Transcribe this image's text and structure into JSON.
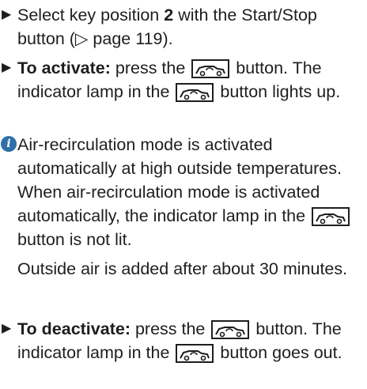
{
  "steps": [
    {
      "text_before": "Select key position ",
      "key_position": "2",
      "text_after": " with the Start/Stop button (▷ page 119)."
    },
    {
      "lead": "To activate:",
      "text_1": " press the ",
      "text_2": " button. The indicator lamp in the ",
      "text_3": " button lights up."
    }
  ],
  "note": {
    "text_1": "Air-recirculation mode is activated automatically at high outside temperatures. When air-recirculation mode is activated automatically, the indicator lamp in the ",
    "text_2": " button is not lit.",
    "text_3": "Outside air is added after about 30 minutes."
  },
  "deactivate": {
    "lead": "To deactivate:",
    "text_1": " press the ",
    "text_2": " button. The indicator lamp in the ",
    "text_3": " button goes out."
  },
  "icons": {
    "bullet": "triangle-bullet-icon",
    "info": "info-icon",
    "button": "air-recirculation-icon"
  },
  "colors": {
    "info_icon": "#2f6fa8",
    "text": "#1e1e1e"
  }
}
